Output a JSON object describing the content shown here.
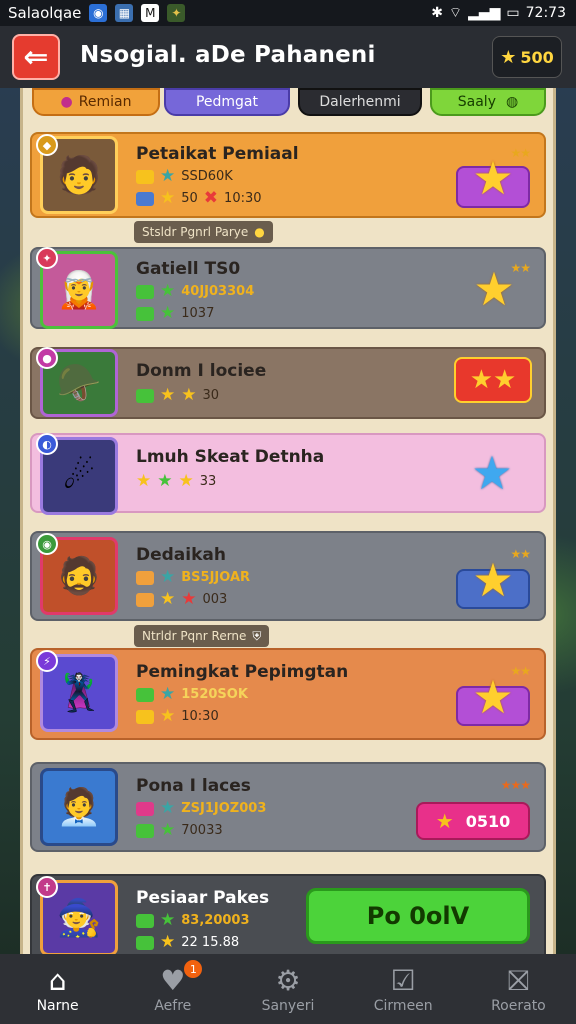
{
  "status_bar": {
    "app_name": "Salaolqae",
    "time": "72:73"
  },
  "header": {
    "title": "Nsogial. aDe Pahaneni",
    "coins": "500"
  },
  "tabs": [
    {
      "label": "Remian"
    },
    {
      "label": "Pedmgat"
    },
    {
      "label": "Dalerhenmi"
    },
    {
      "label": "Saaly"
    }
  ],
  "rows": [
    {
      "name": "Petaikat Pemiaal",
      "line1": "SSD60K",
      "line2": "50",
      "line2b": "10:30",
      "reward": ""
    },
    {
      "name": "Gatiell TS0",
      "line1": "40JJ03304",
      "line2": "1037",
      "reward": ""
    },
    {
      "name": "Donm I lociee",
      "line2": "30",
      "reward": ""
    },
    {
      "name": "Lmuh Skeat Detnha",
      "line2": "33",
      "reward": ""
    },
    {
      "name": "Dedaikah",
      "line1": "BS5JJOAR",
      "line2": "003",
      "reward": ""
    },
    {
      "name": "Pemingkat Pepimgtan",
      "line1": "1520SOK",
      "line2": "10:30",
      "reward": ""
    },
    {
      "name": "Pona I laces",
      "line1": "ZSJ1JOZ003",
      "line2": "70033",
      "reward": "0510"
    },
    {
      "name": "Pesiaar Pakes",
      "line1": "83,20003",
      "line2": "22 15.88",
      "reward": "Po 0olV"
    }
  ],
  "separators": [
    {
      "label": "Stsldr Pgnrl Parye"
    },
    {
      "label": "Ntrldr Pqnr Rerne"
    }
  ],
  "nav": [
    {
      "label": "Narne",
      "icon": "home-icon"
    },
    {
      "label": "Aefre",
      "icon": "heart-icon",
      "badge": "1"
    },
    {
      "label": "Sanyeri",
      "icon": "gear-icon"
    },
    {
      "label": "Cirmeen",
      "icon": "checklist-icon"
    },
    {
      "label": "Roerato",
      "icon": "block-icon"
    }
  ],
  "colors": {
    "accent_red": "#e53b2f",
    "gold": "#ffcf2e",
    "green_button": "#4cd33a",
    "panel": "#efe3c6"
  }
}
